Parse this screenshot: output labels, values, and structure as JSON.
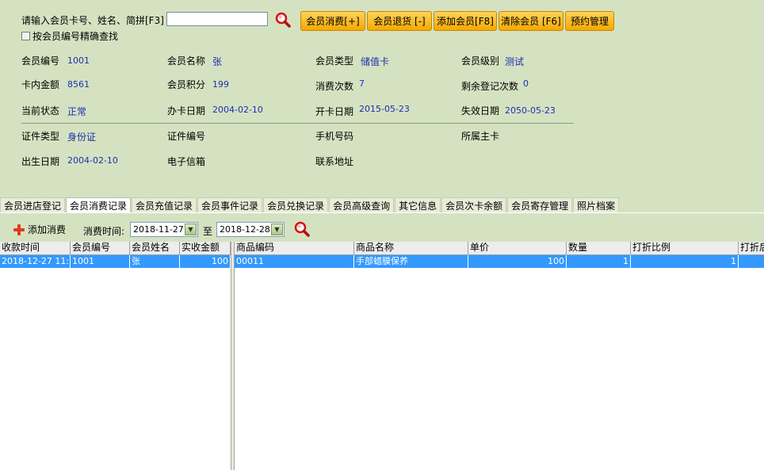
{
  "search": {
    "label": "请输入会员卡号、姓名、简拼[F3]",
    "value": "",
    "exact_label": "按会员编号精确查找"
  },
  "toolbar": {
    "buttons": [
      {
        "label": "会员消费[+]"
      },
      {
        "label": "会员退货 [-]"
      },
      {
        "label": "添加会员[F8]"
      },
      {
        "label": "清除会员 [F6]"
      },
      {
        "label": "预约管理"
      }
    ]
  },
  "member": {
    "fields": [
      {
        "label": "会员编号",
        "value": "1001"
      },
      {
        "label": "会员名称",
        "value": "张"
      },
      {
        "label": "会员类型",
        "value": "储值卡"
      },
      {
        "label": "会员级别",
        "value": "测试"
      },
      {
        "label": "卡内金额",
        "value": "8561"
      },
      {
        "label": "会员积分",
        "value": "199"
      },
      {
        "label": "消费次数",
        "value": "7"
      },
      {
        "label": "剩余登记次数",
        "value": "0"
      },
      {
        "label": "当前状态",
        "value": "正常"
      },
      {
        "label": "办卡日期",
        "value": "2004-02-10"
      },
      {
        "label": "开卡日期",
        "value": "2015-05-23"
      },
      {
        "label": "失效日期",
        "value": "2050-05-23"
      },
      {
        "label": "证件类型",
        "value": "身份证"
      },
      {
        "label": "证件编号",
        "value": ""
      },
      {
        "label": "手机号码",
        "value": ""
      },
      {
        "label": "所属主卡",
        "value": ""
      },
      {
        "label": "出生日期",
        "value": "2004-02-10"
      },
      {
        "label": "电子信箱",
        "value": ""
      },
      {
        "label": "联系地址",
        "value": ""
      }
    ]
  },
  "tabs": [
    {
      "label": "会员进店登记"
    },
    {
      "label": "会员消费记录",
      "active": true
    },
    {
      "label": "会员充值记录"
    },
    {
      "label": "会员事件记录"
    },
    {
      "label": "会员兑换记录"
    },
    {
      "label": "会员高级查询"
    },
    {
      "label": "其它信息"
    },
    {
      "label": "会员次卡余额"
    },
    {
      "label": "会员寄存管理"
    },
    {
      "label": "照片档案"
    }
  ],
  "consume": {
    "add_label": "添加消费",
    "time_label": "消费时间:",
    "from": "2018-11-27",
    "to_label": "至",
    "to": "2018-12-28"
  },
  "left_grid": {
    "columns": [
      "收款时间",
      "会员编号",
      "会员姓名",
      "实收金额"
    ],
    "rows": [
      [
        "2018-12-27 11:",
        "1001",
        "张",
        "100"
      ]
    ]
  },
  "right_grid": {
    "columns": [
      "商品编码",
      "商品名称",
      "单价",
      "数量",
      "打折比例",
      "打折后"
    ],
    "rows": [
      [
        "00011",
        "手部蜡膜保养",
        "100",
        "1",
        "1",
        ""
      ]
    ]
  },
  "colors": {
    "background": "#d5e2c1",
    "button": "#f5a800",
    "value_text": "#1b2fb0",
    "selection": "#3399ff"
  }
}
